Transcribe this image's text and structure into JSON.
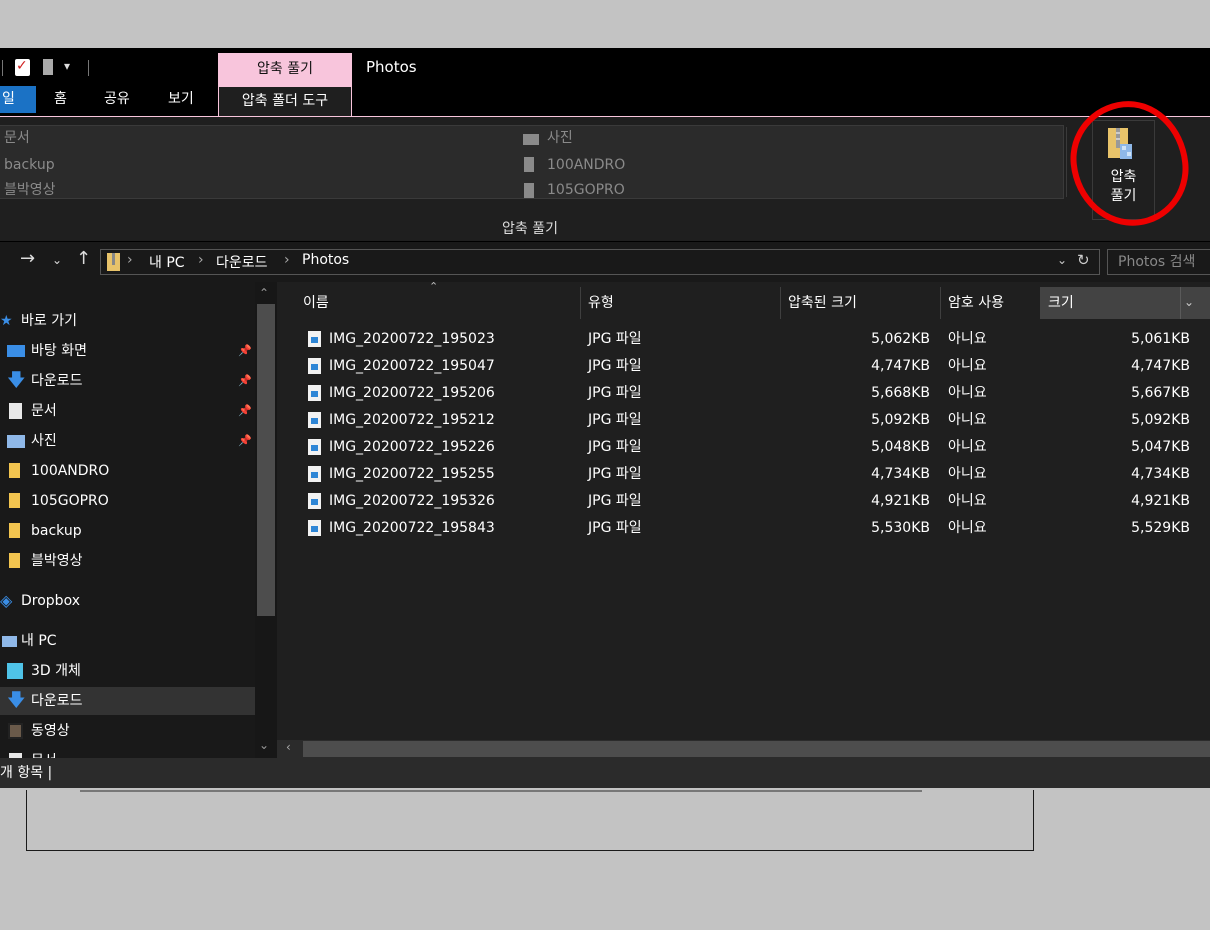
{
  "titlebar": {
    "context_tab": "압축 풀기",
    "title": "Photos"
  },
  "ribbon": {
    "file_tab": "일",
    "tabs": [
      "홈",
      "공유",
      "보기"
    ],
    "active_tab": "압축 폴더 도구",
    "destinations_left": [
      "문서",
      "backup",
      "블박영상"
    ],
    "destinations_right": [
      "사진",
      "100ANDRO",
      "105GOPRO"
    ],
    "extract_all_label_1": "압축",
    "extract_all_label_2": "풀기",
    "group_label": "압축 풀기"
  },
  "address": {
    "crumbs": [
      "내 PC",
      "다운로드",
      "Photos"
    ],
    "search_placeholder": "Photos 검색"
  },
  "nav": {
    "items": [
      {
        "label": "바로 가기",
        "icon": "star-icon",
        "level": 0,
        "pinned": false
      },
      {
        "label": "바탕 화면",
        "icon": "desktop-icon",
        "level": 1,
        "pinned": true
      },
      {
        "label": "다운로드",
        "icon": "download-icon",
        "level": 1,
        "pinned": true
      },
      {
        "label": "문서",
        "icon": "document-icon",
        "level": 1,
        "pinned": true
      },
      {
        "label": "사진",
        "icon": "pictures-icon",
        "level": 1,
        "pinned": true
      },
      {
        "label": "100ANDRO",
        "icon": "folder-icon",
        "level": 1,
        "pinned": false
      },
      {
        "label": "105GOPRO",
        "icon": "folder-icon",
        "level": 1,
        "pinned": false
      },
      {
        "label": "backup",
        "icon": "folder-icon",
        "level": 1,
        "pinned": false
      },
      {
        "label": "블박영상",
        "icon": "folder-icon",
        "level": 1,
        "pinned": false
      },
      {
        "label": "Dropbox",
        "icon": "dropbox-icon",
        "level": 0,
        "pinned": false
      },
      {
        "label": "내 PC",
        "icon": "pc-icon",
        "level": 0,
        "pinned": false
      },
      {
        "label": "3D 개체",
        "icon": "cube-icon",
        "level": 1,
        "pinned": false
      },
      {
        "label": "다운로드",
        "icon": "download-icon",
        "level": 1,
        "pinned": false,
        "selected": true
      },
      {
        "label": "동영상",
        "icon": "video-icon",
        "level": 1,
        "pinned": false
      },
      {
        "label": "문서",
        "icon": "document-icon",
        "level": 1,
        "pinned": false
      }
    ]
  },
  "files": {
    "headers": {
      "name": "이름",
      "type": "유형",
      "compressed": "압축된 크기",
      "password": "암호 사용",
      "size": "크기"
    },
    "rows": [
      {
        "name": "IMG_20200722_195023",
        "type": "JPG 파일",
        "compressed": "5,062KB",
        "password": "아니요",
        "size": "5,061KB"
      },
      {
        "name": "IMG_20200722_195047",
        "type": "JPG 파일",
        "compressed": "4,747KB",
        "password": "아니요",
        "size": "4,747KB"
      },
      {
        "name": "IMG_20200722_195206",
        "type": "JPG 파일",
        "compressed": "5,668KB",
        "password": "아니요",
        "size": "5,667KB"
      },
      {
        "name": "IMG_20200722_195212",
        "type": "JPG 파일",
        "compressed": "5,092KB",
        "password": "아니요",
        "size": "5,092KB"
      },
      {
        "name": "IMG_20200722_195226",
        "type": "JPG 파일",
        "compressed": "5,048KB",
        "password": "아니요",
        "size": "5,047KB"
      },
      {
        "name": "IMG_20200722_195255",
        "type": "JPG 파일",
        "compressed": "4,734KB",
        "password": "아니요",
        "size": "4,734KB"
      },
      {
        "name": "IMG_20200722_195326",
        "type": "JPG 파일",
        "compressed": "4,921KB",
        "password": "아니요",
        "size": "4,921KB"
      },
      {
        "name": "IMG_20200722_195843",
        "type": "JPG 파일",
        "compressed": "5,530KB",
        "password": "아니요",
        "size": "5,529KB"
      }
    ]
  },
  "status": {
    "text": "개 항목  |"
  },
  "colors": {
    "context_pink": "#f8c5dc",
    "file_tab_blue": "#1b72c5",
    "highlight_red": "#ee0000"
  }
}
